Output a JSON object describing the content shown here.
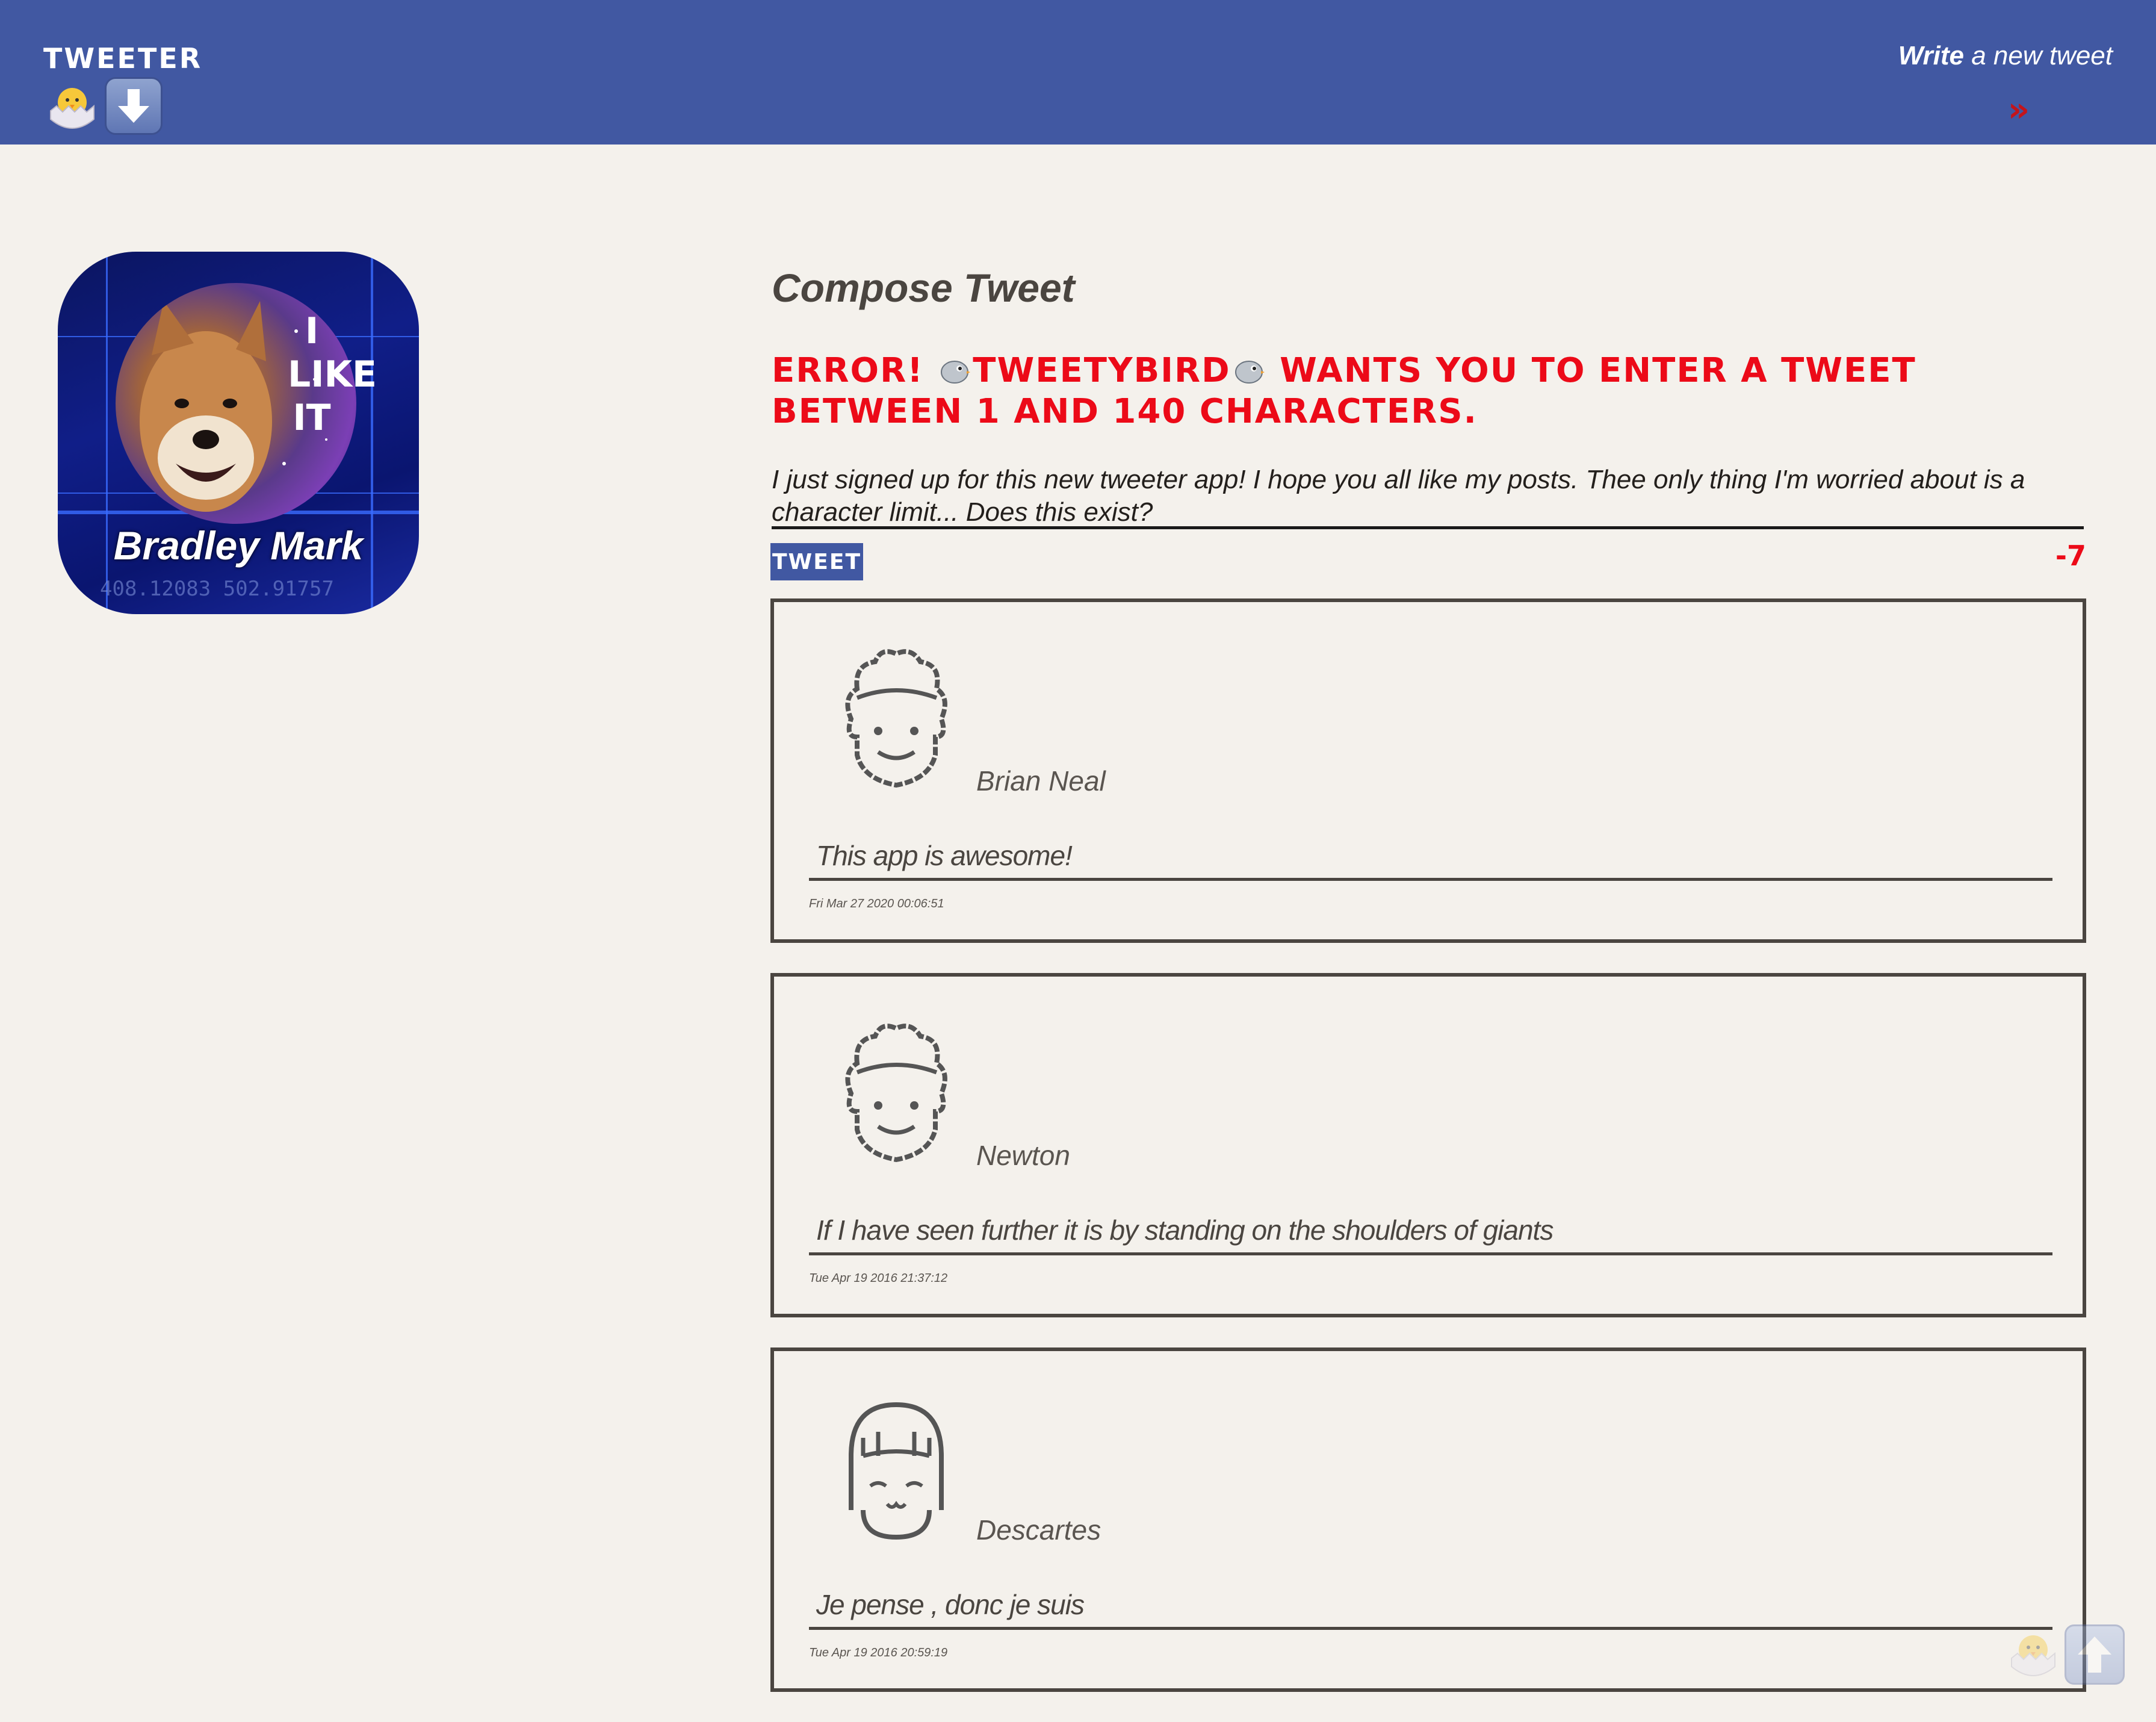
{
  "nav": {
    "brand": "TWEETER",
    "write_bold": "Write",
    "write_rest": " a new tweet",
    "write_arrow": "»"
  },
  "profile": {
    "name": "Bradley Mark",
    "image_text": "I LIKE IT",
    "image_numbers": "408.12083 502.91757"
  },
  "compose": {
    "title": "Compose Tweet",
    "error_prefix": "ERROR! ",
    "error_handle": "TWEETYBIRD",
    "error_suffix": " WANTS YOU TO ENTER A TWEET BETWEEN 1 AND 140 CHARACTERS.",
    "text": "I just signed up for this new tweeter app! I hope you all like my posts. Thee only thing I'm worried about is a character limit... Does this exist?",
    "button": "TWEET",
    "counter": "-7"
  },
  "tweets": [
    {
      "handle": "Brian Neal",
      "body": "This app is awesome!",
      "date": "Fri Mar 27 2020 00:06:51",
      "avatar_icon": "curly-hair-face-icon"
    },
    {
      "handle": "Newton",
      "body": "If I have seen further it is by standing on the shoulders of giants",
      "date": "Tue Apr 19 2016 21:37:12",
      "avatar_icon": "curly-hair-face-icon"
    },
    {
      "handle": "Descartes",
      "body": "Je pense , donc je suis",
      "date": "Tue Apr 19 2016 20:59:19",
      "avatar_icon": "bob-hair-face-icon"
    }
  ],
  "colors": {
    "nav": "#4158a2",
    "background": "#f4f1ec",
    "error": "#ec0a18",
    "text": "#4a4540"
  }
}
